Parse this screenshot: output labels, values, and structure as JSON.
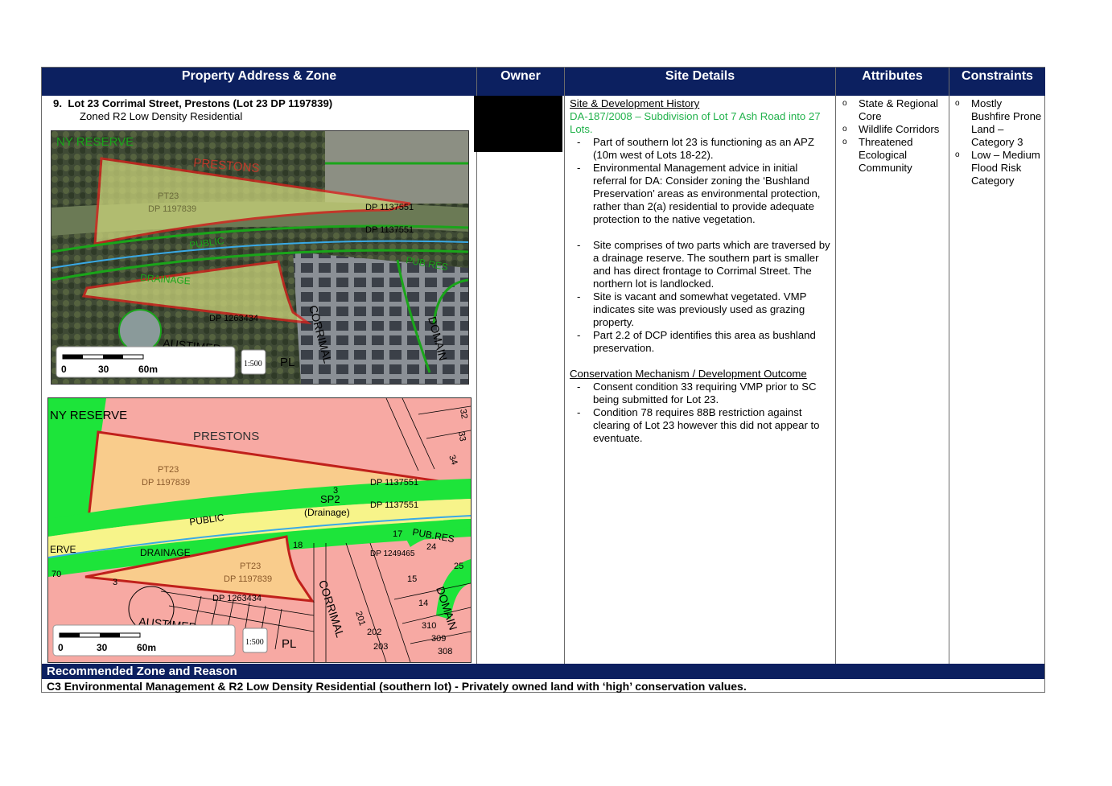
{
  "headers": {
    "address": "Property Address & Zone",
    "owner": "Owner",
    "site": "Site Details",
    "attributes": "Attributes",
    "constraints": "Constraints"
  },
  "property": {
    "number": "9.",
    "address": "Lot 23 Corrimal Street, Prestons (Lot 23 DP 1197839)",
    "zone": "Zoned R2 Low Density Residential"
  },
  "aerial_map": {
    "labels": {
      "reserve": "NY RESERVE",
      "prestons": "PRESTONS",
      "pt23": "PT23",
      "dp1197839": "DP 1197839",
      "dp1137551a": "DP 1137551",
      "dp1137551b": "DP 1137551",
      "public": "PUBLIC",
      "drainage": "DRAINAGE",
      "pubres": "PUB.RES",
      "corrimal": "CORRIMAL",
      "domain": "DOMAIN",
      "austimer": "AUSTIMER",
      "dp1263434": "DP 1263434",
      "pl": "PL"
    },
    "scale": {
      "s0": "0",
      "s30": "30",
      "s60": "60m",
      "ratio": "1:500"
    }
  },
  "zoning_map": {
    "labels": {
      "reserve": "NY RESERVE",
      "prestons": "PRESTONS",
      "pt23a": "PT23",
      "dp1197839a": "DP 1197839",
      "dp1137551a": "DP 1137551",
      "dp1137551b": "DP 1137551",
      "sp2": "SP2",
      "drainage_paren": "(Drainage)",
      "public": "PUBLIC",
      "drainage": "DRAINAGE",
      "erve": "ERVE",
      "pubres": "PUB.RES",
      "pt23b": "PT23",
      "dp1197839b": "DP 1197839",
      "dp1263434": "DP 1263434",
      "corrimal": "CORRIMAL",
      "domain": "DOMAIN",
      "austimer": "AUSTIMER",
      "pl": "PL",
      "dp1249465": "DP 1249465",
      "n17": "17",
      "n18": "18",
      "n24": "24",
      "n25": "25",
      "n15": "15",
      "n14": "14",
      "n310": "310",
      "n309": "309",
      "n308": "308",
      "n202": "202",
      "n203": "203",
      "n201": "201",
      "n3a": "3",
      "n3b": "3",
      "n70": "70",
      "n33": "33",
      "n32": "32",
      "n34": "34"
    },
    "scale": {
      "s0": "0",
      "s30": "30",
      "s60": "60m",
      "ratio": "1:500"
    }
  },
  "site_details": {
    "history_heading": "Site & Development History",
    "da_ref": "DA-187/2008 – Subdivision of Lot 7 Ash Road into 27 Lots.",
    "history_items": [
      "Part of southern lot 23 is functioning as an APZ (10m west of Lots 18-22).",
      "Environmental Management advice in initial referral for DA: Consider zoning the ‘Bushland Preservation’ areas as environmental protection, rather than 2(a) residential to provide adequate protection to the native vegetation."
    ],
    "site_items": [
      "Site comprises of two parts which are traversed by a drainage reserve. The southern part is smaller and has direct frontage to Corrimal Street. The northern lot is landlocked.",
      "Site is vacant and somewhat vegetated. VMP indicates site was previously used as grazing property.",
      "Part 2.2 of DCP identifies this area as bushland preservation."
    ],
    "conservation_heading": "Conservation Mechanism / Development Outcome",
    "conservation_items": [
      "Consent condition 33 requiring VMP prior to SC being submitted for Lot 23.",
      "Condition 78 requires 88B restriction against clearing of Lot 23 however this did not appear to eventuate."
    ]
  },
  "attributes": [
    "State & Regional Core",
    "Wildlife Corridors",
    "Threatened Ecological Community"
  ],
  "constraints": [
    "Mostly Bushfire Prone Land – Category 3",
    "Low – Medium Flood Risk Category"
  ],
  "recommendation": {
    "heading": "Recommended Zone and Reason",
    "text": "C3 Environmental Management & R2 Low Density Residential (southern lot) - Privately owned land with ‘high’ conservation values."
  }
}
